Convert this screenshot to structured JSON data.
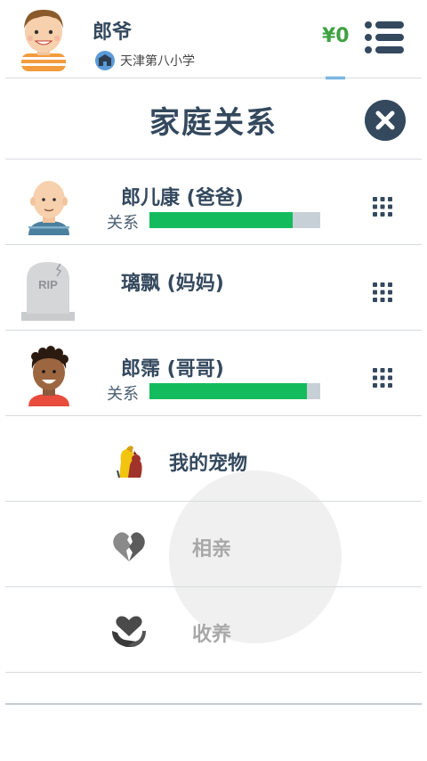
{
  "header": {
    "player_name": "郎爷",
    "school": "天津第八小学",
    "money": "¥0",
    "menu_icon": "list-menu-icon"
  },
  "title": "家庭关系",
  "close_icon": "close-x-icon",
  "family": [
    {
      "name": "郎儿康 (爸爸)",
      "relation_label": "关系",
      "relation_level": 0.84,
      "avatar": "bald-man-avatar"
    },
    {
      "name": "璃飘 (妈妈)",
      "deceased": true,
      "tombstone_text": "RIP",
      "avatar": "tombstone-icon"
    },
    {
      "name": "郎霈 (哥哥)",
      "relation_label": "关系",
      "relation_level": 0.92,
      "avatar": "curly-boy-avatar"
    }
  ],
  "actions": [
    {
      "label": "我的宠物",
      "icon": "pets-icon",
      "enabled": true
    },
    {
      "label": "相亲",
      "icon": "broken-heart-icon",
      "enabled": false
    },
    {
      "label": "收养",
      "icon": "hands-heart-icon",
      "enabled": false
    }
  ],
  "colors": {
    "primary": "#34495e",
    "money": "#3fa244",
    "relation_fill": "#14bb5c",
    "relation_track": "#c8d0d7",
    "disabled_text": "#a8a8a8"
  }
}
